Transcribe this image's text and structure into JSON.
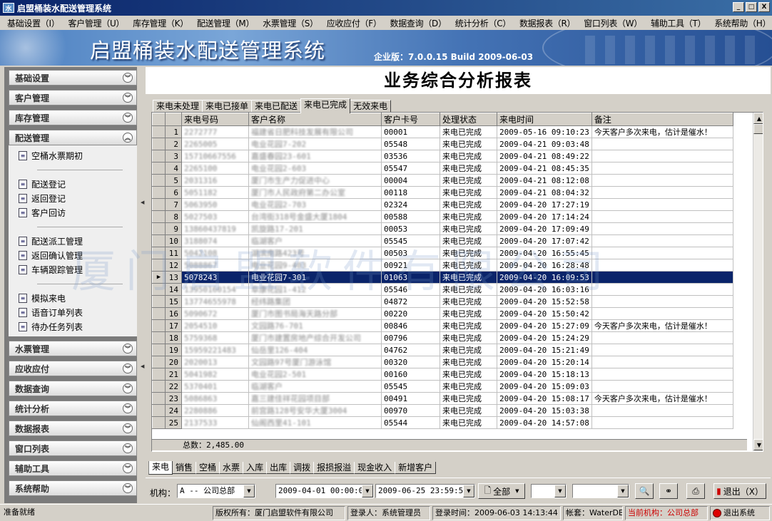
{
  "window": {
    "title": "启盟桶装水配送管理系统",
    "min": "_",
    "max": "□",
    "close": "X"
  },
  "menu": [
    "基础设置（I）",
    "客户管理（U）",
    "库存管理（K）",
    "配送管理（M）",
    "水票管理（S）",
    "应收应付（F）",
    "数据查询（D）",
    "统计分析（C）",
    "数据报表（R）",
    "窗口列表（W）",
    "辅助工具（T）",
    "系统帮助（H）"
  ],
  "banner": {
    "title": "启盟桶装水配送管理系统",
    "version": "企业版：7.0.0.15 Build 2009-06-03"
  },
  "sidebar": {
    "top_groups": [
      "基础设置",
      "客户管理",
      "库存管理",
      "配送管理"
    ],
    "items_a": [
      "空桶水票期初"
    ],
    "items_b": [
      "配送登记",
      "返回登记",
      "客户回访"
    ],
    "items_c": [
      "配送派工管理",
      "返回确认管理",
      "车辆跟踪管理"
    ],
    "items_d": [
      "模拟来电",
      "语音订单列表",
      "待办任务列表"
    ],
    "bottom_groups": [
      "水票管理",
      "应收应付",
      "数据查询",
      "统计分析",
      "数据报表",
      "窗口列表",
      "辅助工具",
      "系统帮助"
    ]
  },
  "report": {
    "title": "业务综合分析报表",
    "tabs": [
      "来电未处理",
      "来电已接单",
      "来电已配送",
      "来电已完成",
      "无效来电"
    ],
    "active_tab": "来电已完成",
    "columns": [
      "来电号码",
      "客户名称",
      "客户卡号",
      "处理状态",
      "来电时间",
      "备注"
    ],
    "selected_row": 13,
    "rows": [
      [
        "1",
        "2272777",
        "福建省日肥科技发展有限公司",
        "00001",
        "来电已完成",
        "2009-05-16 09:10:23",
        "今天客户多次来电，估计是催水！"
      ],
      [
        "2",
        "2265005",
        "电业花园7-202",
        "05548",
        "来电已完成",
        "2009-04-21 09:03:48",
        ""
      ],
      [
        "3",
        "15710667556",
        "嘉盛春园23-601",
        "03536",
        "来电已完成",
        "2009-04-21 08:49:22",
        ""
      ],
      [
        "4",
        "2265100",
        "电业花园2-603",
        "05547",
        "来电已完成",
        "2009-04-21 08:45:35",
        ""
      ],
      [
        "5",
        "2031316",
        "厦门市生产力促进中心",
        "00004",
        "来电已完成",
        "2009-04-21 08:12:08",
        ""
      ],
      [
        "6",
        "5051182",
        "厦门市人民政府第二办公室",
        "00118",
        "来电已完成",
        "2009-04-21 08:04:32",
        ""
      ],
      [
        "7",
        "5063950",
        "电业花园2-703",
        "02324",
        "来电已完成",
        "2009-04-20 17:27:19",
        ""
      ],
      [
        "8",
        "5027503",
        "台湾街318号金盛大厦1804",
        "00588",
        "来电已完成",
        "2009-04-20 17:14:24",
        ""
      ],
      [
        "9",
        "13860437819",
        "凯旋路17-201",
        "00053",
        "来电已完成",
        "2009-04-20 17:09:49",
        ""
      ],
      [
        "10",
        "3188074",
        "临湖客户",
        "05545",
        "来电已完成",
        "2009-04-20 17:07:42",
        ""
      ],
      [
        "11",
        "5042108",
        "湖滨南路423号",
        "00503",
        "来电已完成",
        "2009-04-20 16:55:45",
        ""
      ],
      [
        "12",
        "5088867",
        "电业花园9-403",
        "00921",
        "来电已完成",
        "2009-04-20 16:28:48",
        ""
      ],
      [
        "13",
        "5078243",
        "电业花园7-301",
        "01063",
        "来电已完成",
        "2009-04-20 16:09:53",
        ""
      ],
      [
        "14",
        "13950160154",
        "阜康花园1-412",
        "05546",
        "来电已完成",
        "2009-04-20 16:03:16",
        ""
      ],
      [
        "15",
        "13774655978",
        "经纬路集团",
        "04872",
        "来电已完成",
        "2009-04-20 15:52:58",
        ""
      ],
      [
        "16",
        "5090672",
        "厦门市图书局海天路分部",
        "00220",
        "来电已完成",
        "2009-04-20 15:50:42",
        ""
      ],
      [
        "17",
        "2054510",
        "文园路76-701",
        "00846",
        "来电已完成",
        "2009-04-20 15:27:09",
        "今天客户多次来电，估计是催水！"
      ],
      [
        "18",
        "5759368",
        "厦门市建置房地产综合开发公司",
        "00796",
        "来电已完成",
        "2009-04-20 15:24:29",
        ""
      ],
      [
        "19",
        "15959221483",
        "仙岳里126-404",
        "04762",
        "来电已完成",
        "2009-04-20 15:21:49",
        ""
      ],
      [
        "20",
        "2020013",
        "文园路97号厦门游泳馆",
        "00320",
        "来电已完成",
        "2009-04-20 15:20:14",
        ""
      ],
      [
        "21",
        "5041982",
        "电业花园2-501",
        "00160",
        "来电已完成",
        "2009-04-20 15:18:13",
        ""
      ],
      [
        "22",
        "5370401",
        "临湖客户",
        "05545",
        "来电已完成",
        "2009-04-20 15:09:03",
        ""
      ],
      [
        "23",
        "5086863",
        "嘉三建佳祥花园项目部",
        "00491",
        "来电已完成",
        "2009-04-20 15:08:17",
        "今天客户多次来电，估计是催水！"
      ],
      [
        "24",
        "2280886",
        "前宫路128号安华大厦3004",
        "00970",
        "来电已完成",
        "2009-04-20 15:03:38",
        ""
      ],
      [
        "25",
        "2137533",
        "仙阁西里41-101",
        "05544",
        "来电已完成",
        "2009-04-20 14:57:08",
        ""
      ]
    ],
    "total": "总数：2,485.00",
    "bottom_tabs": [
      "来电",
      "销售",
      "空桶",
      "水票",
      "入库",
      "出库",
      "调拨",
      "报损报溢",
      "现金收入",
      "新增客户"
    ],
    "active_bottom_tab": "来电"
  },
  "toolbar": {
    "org_label": "机构：",
    "org_value": "A -- 公司总部",
    "date_from": "2009-04-01 00:00:00",
    "date_to": "2009-06-25 23:59:59",
    "scope": "全部",
    "exit_label": "退出（X）"
  },
  "status": {
    "ready": "准备就绪",
    "copyright": "版权所有：厦门启盟软件有限公司",
    "user": "登录人：系统管理员",
    "login_time": "登录时间：2009-06-03 14:13:44",
    "account": "帐套：WaterDB",
    "org": "当前机构：公司总部",
    "exit": "退出系统"
  },
  "watermark": "厦门启盟软件有限公司",
  "colors": {
    "selected_row": "#0a246a",
    "titlebar": "#0a246a",
    "org_status": "#cc0000"
  }
}
